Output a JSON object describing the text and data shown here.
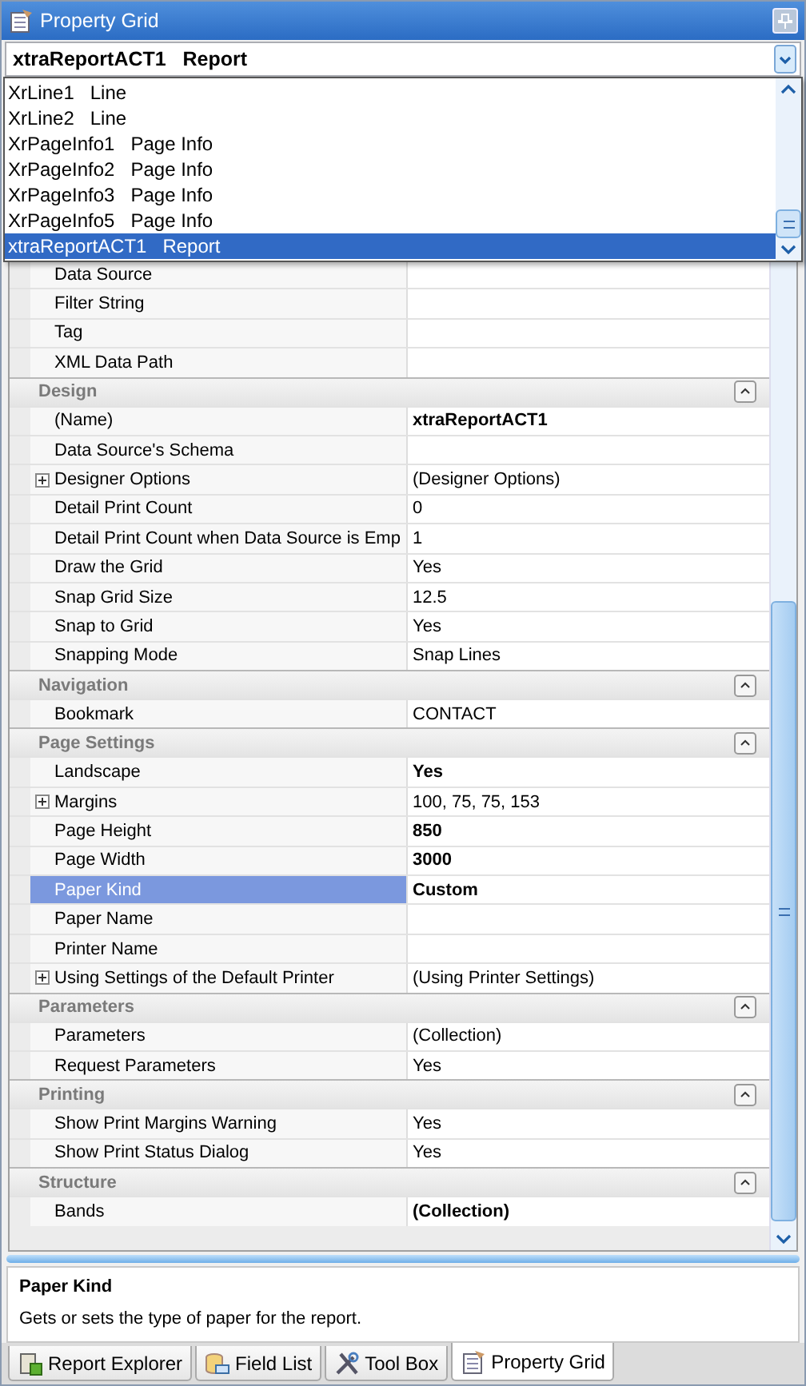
{
  "window": {
    "title": "Property Grid"
  },
  "object_selector": {
    "name": "xtraReportACT1",
    "type": "Report"
  },
  "dropdown": {
    "items": [
      {
        "name": "XrLine1",
        "type": "Line",
        "selected": false
      },
      {
        "name": "XrLine2",
        "type": "Line",
        "selected": false
      },
      {
        "name": "XrPageInfo1",
        "type": "Page Info",
        "selected": false
      },
      {
        "name": "XrPageInfo2",
        "type": "Page Info",
        "selected": false
      },
      {
        "name": "XrPageInfo3",
        "type": "Page Info",
        "selected": false
      },
      {
        "name": "XrPageInfo5",
        "type": "Page Info",
        "selected": false
      },
      {
        "name": "xtraReportACT1",
        "type": "Report",
        "selected": true
      }
    ]
  },
  "grid": {
    "sections": [
      {
        "rows": [
          {
            "name": "Data Source",
            "value": "",
            "expandable": false,
            "selected": false
          },
          {
            "name": "Filter String",
            "value": "",
            "expandable": false,
            "selected": false
          },
          {
            "name": "Tag",
            "value": "",
            "expandable": false,
            "selected": false
          },
          {
            "name": "XML Data Path",
            "value": "",
            "expandable": false,
            "selected": false
          }
        ]
      },
      {
        "title": "Design",
        "rows": [
          {
            "name": "(Name)",
            "value": "xtraReportACT1",
            "modified": true,
            "expandable": false,
            "selected": false
          },
          {
            "name": "Data Source's Schema",
            "value": "",
            "expandable": false,
            "selected": false
          },
          {
            "name": "Designer Options",
            "value": "(Designer Options)",
            "modified": false,
            "expandable": true,
            "selected": false
          },
          {
            "name": "Detail Print Count",
            "value": "0",
            "modified": false,
            "expandable": false,
            "selected": false
          },
          {
            "name": "Detail Print Count when Data Source is Emp",
            "value": "1",
            "modified": false,
            "expandable": false,
            "selected": false
          },
          {
            "name": "Draw the Grid",
            "value": "Yes",
            "modified": false,
            "expandable": false,
            "selected": false
          },
          {
            "name": "Snap Grid Size",
            "value": "12.5",
            "modified": false,
            "expandable": false,
            "selected": false
          },
          {
            "name": "Snap to Grid",
            "value": "Yes",
            "modified": false,
            "expandable": false,
            "selected": false
          },
          {
            "name": "Snapping Mode",
            "value": "Snap Lines",
            "modified": false,
            "expandable": false,
            "selected": false
          }
        ]
      },
      {
        "title": "Navigation",
        "rows": [
          {
            "name": "Bookmark",
            "value": "CONTACT",
            "modified": false,
            "expandable": false,
            "selected": false
          }
        ]
      },
      {
        "title": "Page Settings",
        "rows": [
          {
            "name": "Landscape",
            "value": "Yes",
            "modified": true,
            "expandable": false,
            "selected": false
          },
          {
            "name": "Margins",
            "value": "100, 75, 75, 153",
            "modified": false,
            "expandable": true,
            "selected": false
          },
          {
            "name": "Page Height",
            "value": "850",
            "modified": true,
            "expandable": false,
            "selected": false
          },
          {
            "name": "Page Width",
            "value": "3000",
            "modified": true,
            "expandable": false,
            "selected": false
          },
          {
            "name": "Paper Kind",
            "value": "Custom",
            "modified": true,
            "expandable": false,
            "selected": true
          },
          {
            "name": "Paper Name",
            "value": "",
            "expandable": false,
            "selected": false
          },
          {
            "name": "Printer Name",
            "value": "",
            "expandable": false,
            "selected": false
          },
          {
            "name": "Using Settings of the Default Printer",
            "value": "(Using Printer Settings)",
            "modified": false,
            "expandable": true,
            "selected": false
          }
        ]
      },
      {
        "title": "Parameters",
        "rows": [
          {
            "name": "Parameters",
            "value": "(Collection)",
            "modified": false,
            "expandable": false,
            "selected": false
          },
          {
            "name": "Request Parameters",
            "value": "Yes",
            "modified": false,
            "expandable": false,
            "selected": false
          }
        ]
      },
      {
        "title": "Printing",
        "rows": [
          {
            "name": "Show Print Margins Warning",
            "value": "Yes",
            "modified": false,
            "expandable": false,
            "selected": false
          },
          {
            "name": "Show Print Status Dialog",
            "value": "Yes",
            "modified": false,
            "expandable": false,
            "selected": false
          }
        ]
      },
      {
        "title": "Structure",
        "rows": [
          {
            "name": "Bands",
            "value": "(Collection)",
            "modified": true,
            "expandable": false,
            "selected": false
          }
        ]
      }
    ]
  },
  "description": {
    "title": "Paper Kind",
    "text": "Gets or sets the type of paper for the report."
  },
  "tabs": [
    {
      "label": "Report Explorer",
      "kind": "explorer",
      "selected": false
    },
    {
      "label": "Field List",
      "kind": "fields",
      "selected": false
    },
    {
      "label": "Tool Box",
      "kind": "tools",
      "selected": false
    },
    {
      "label": "Property Grid",
      "kind": "grid",
      "selected": true
    }
  ]
}
